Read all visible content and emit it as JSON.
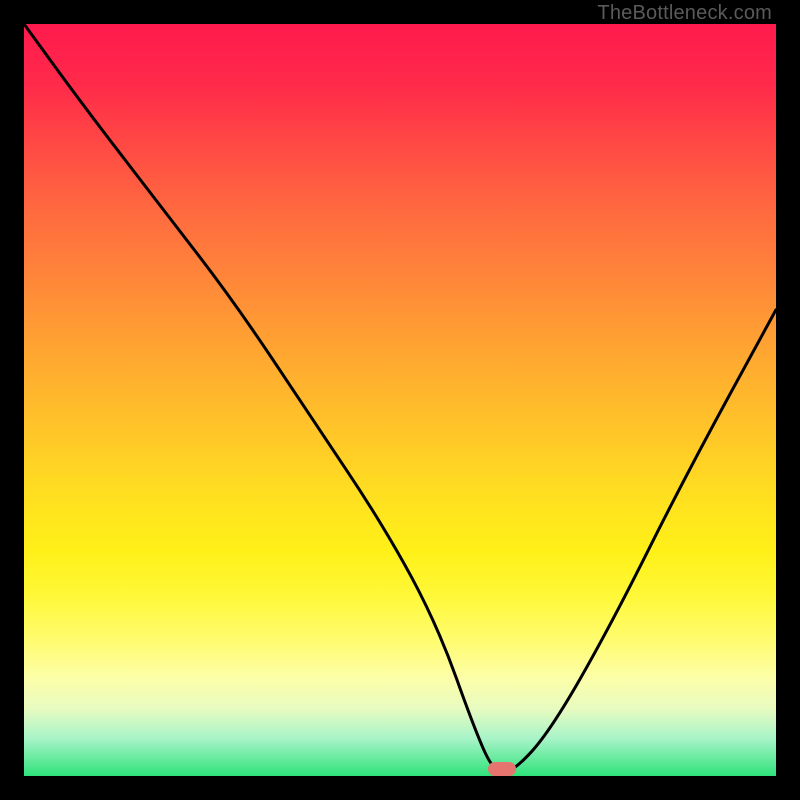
{
  "watermark": "TheBottleneck.com",
  "chart_data": {
    "type": "line",
    "title": "",
    "xlabel": "",
    "ylabel": "",
    "xlim": [
      0,
      100
    ],
    "ylim": [
      0,
      100
    ],
    "series": [
      {
        "name": "bottleneck-curve",
        "x": [
          0,
          8,
          18,
          28,
          38,
          48,
          55,
          60,
          62.5,
          65,
          70,
          78,
          88,
          100
        ],
        "y": [
          100,
          89,
          76,
          63,
          48,
          33,
          20,
          6,
          0.5,
          0.5,
          6,
          20,
          40,
          62
        ]
      }
    ],
    "marker": {
      "x": 63.5,
      "y": 0.9
    },
    "gradient_stops": [
      {
        "pos": 0,
        "color": "#ff1a4d"
      },
      {
        "pos": 50,
        "color": "#ffc828"
      },
      {
        "pos": 82,
        "color": "#fffc70"
      },
      {
        "pos": 100,
        "color": "#2ee27a"
      }
    ]
  }
}
